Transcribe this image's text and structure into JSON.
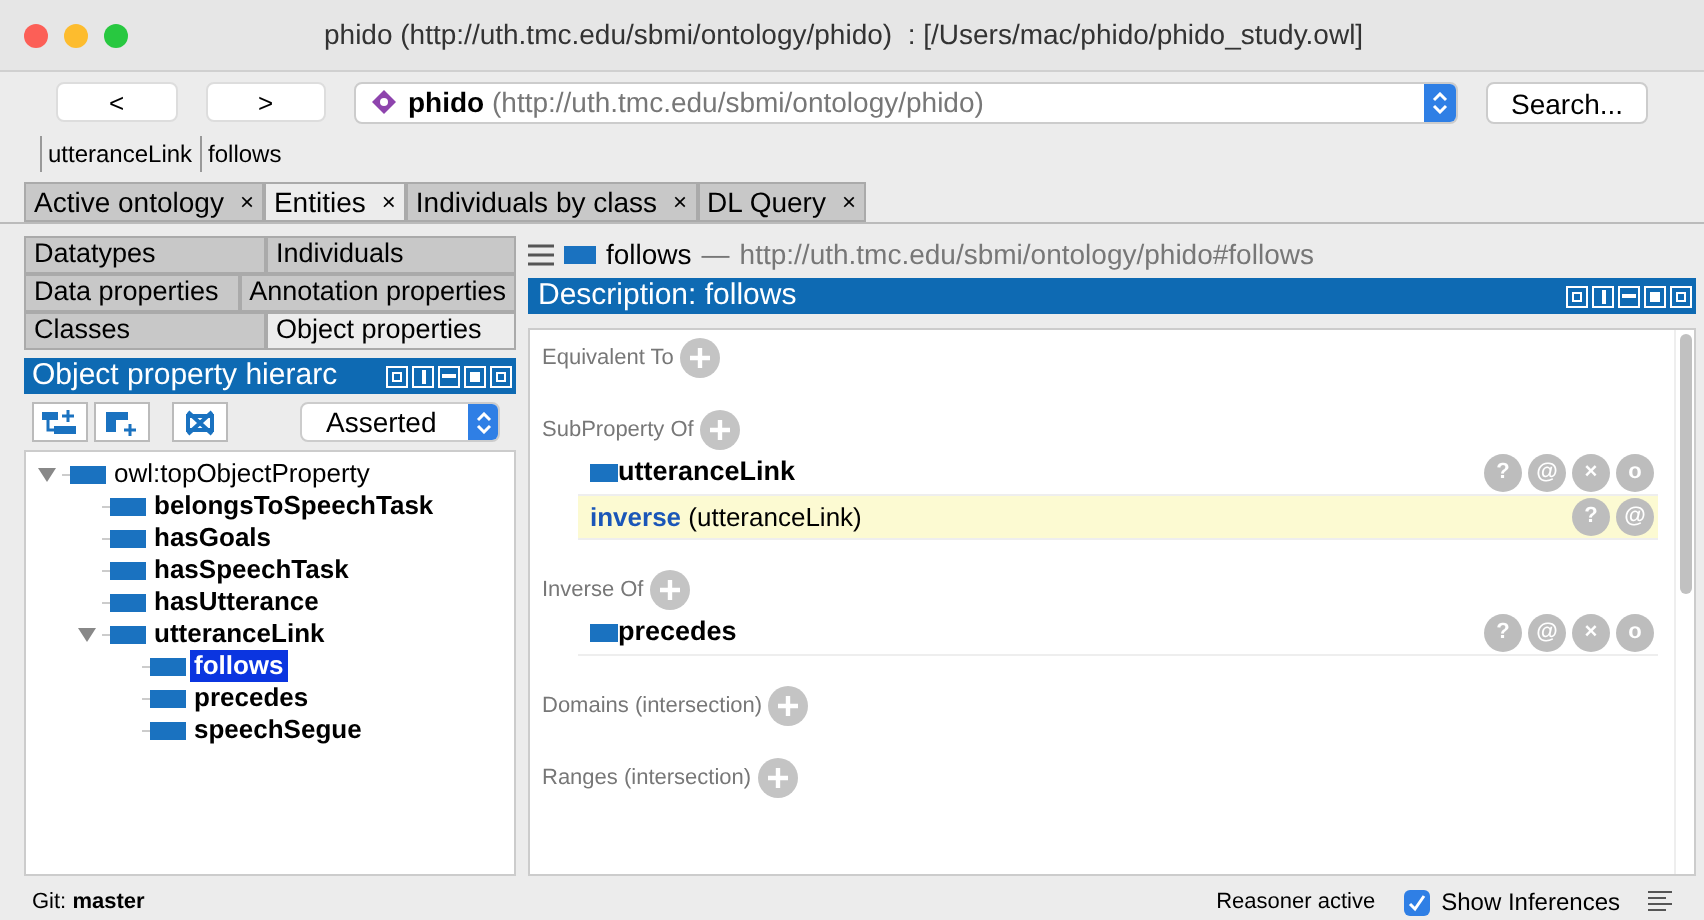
{
  "window": {
    "title": "phido (http://uth.tmc.edu/sbmi/ontology/phido)  : [/Users/mac/phido/phido_study.owl]"
  },
  "nav": {
    "back": "<",
    "forward": ">",
    "ontology_name": "phido",
    "ontology_iri": "(http://uth.tmc.edu/sbmi/ontology/phido)",
    "search": "Search..."
  },
  "breadcrumb": [
    "utteranceLink",
    "follows"
  ],
  "tabs": [
    {
      "label": "Active ontology",
      "close": "×",
      "selected": false
    },
    {
      "label": "Entities",
      "close": "×",
      "selected": true
    },
    {
      "label": "Individuals by class",
      "close": "×",
      "selected": false
    },
    {
      "label": "DL Query",
      "close": "×",
      "selected": false
    }
  ],
  "entity_tabs": [
    [
      {
        "label": "Datatypes",
        "selected": false
      },
      {
        "label": "Individuals",
        "selected": false
      }
    ],
    [
      {
        "label": "Data properties",
        "selected": false
      },
      {
        "label": "Annotation properties",
        "selected": false
      }
    ],
    [
      {
        "label": "Classes",
        "selected": false
      },
      {
        "label": "Object properties",
        "selected": true
      }
    ]
  ],
  "hierarchy": {
    "title": "Object property hierarc",
    "mode": "Asserted",
    "tree": [
      {
        "label": "owl:topObjectProperty",
        "selected": false,
        "expanded": true,
        "children": [
          {
            "label": "belongsToSpeechTask",
            "selected": false
          },
          {
            "label": "hasGoals",
            "selected": false
          },
          {
            "label": "hasSpeechTask",
            "selected": false
          },
          {
            "label": "hasUtterance",
            "selected": false
          },
          {
            "label": "utteranceLink",
            "selected": false,
            "expanded": true,
            "children": [
              {
                "label": "follows",
                "selected": true
              },
              {
                "label": "precedes",
                "selected": false
              },
              {
                "label": "speechSegue",
                "selected": false
              }
            ]
          }
        ]
      }
    ]
  },
  "entity_header": {
    "name": "follows",
    "dash": "—",
    "iri": "http://uth.tmc.edu/sbmi/ontology/phido#follows"
  },
  "description": {
    "title": "Description: follows",
    "sections": [
      {
        "title": "Equivalent To"
      },
      {
        "title": "SubProperty Of",
        "items": [
          {
            "kind": "entity",
            "label": "utteranceLink",
            "inferred": false,
            "buttons": [
              "?",
              "@",
              "×",
              "o"
            ]
          },
          {
            "kind": "expression",
            "keyword": "inverse",
            "text": "(utteranceLink)",
            "inferred": true,
            "buttons": [
              "?",
              "@"
            ]
          }
        ]
      },
      {
        "title": "Inverse Of",
        "items": [
          {
            "kind": "entity",
            "label": "precedes",
            "inferred": false,
            "buttons": [
              "?",
              "@",
              "×",
              "o"
            ]
          }
        ]
      },
      {
        "title": "Domains (intersection)"
      },
      {
        "title": "Ranges (intersection)"
      }
    ]
  },
  "status_bar": {
    "git_label": "Git:",
    "branch": "master",
    "reasoner": "Reasoner active",
    "show_inferences": {
      "label": "Show Inferences",
      "checked": true
    }
  }
}
